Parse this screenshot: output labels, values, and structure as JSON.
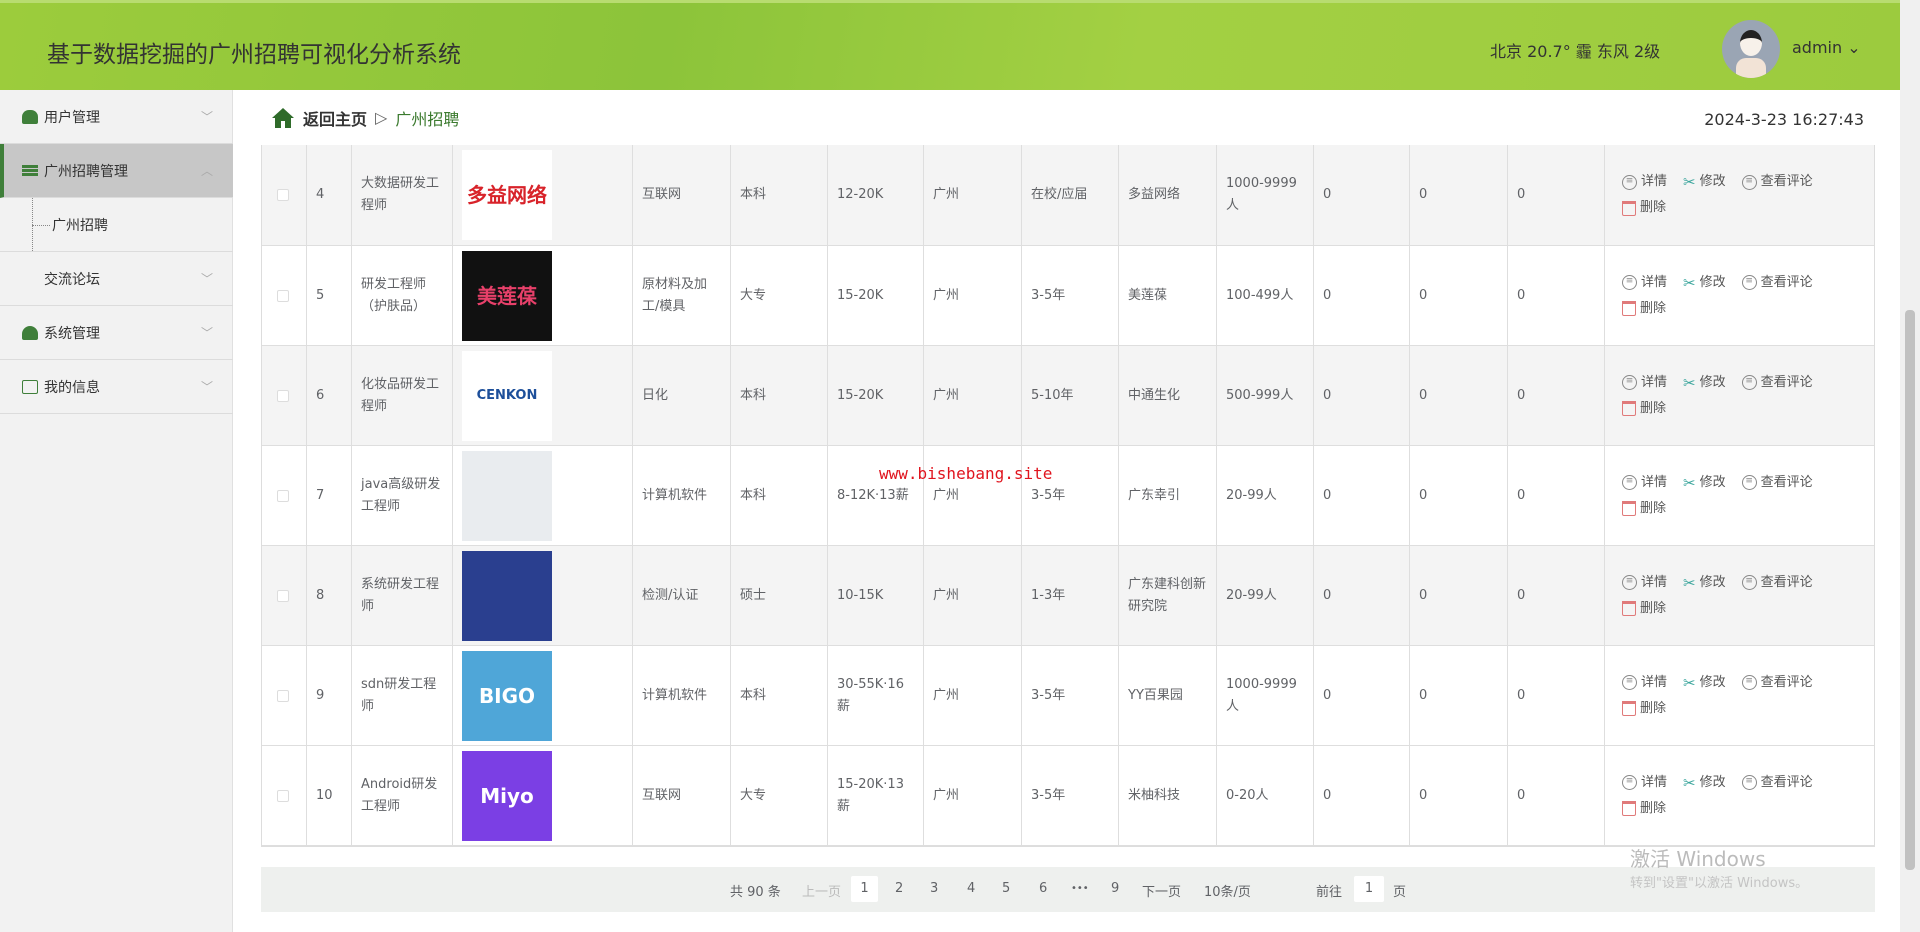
{
  "header": {
    "title": "基于数据挖掘的广州招聘可视化分析系统",
    "weather": "北京 20.7° 霾 东风 2级",
    "user": "admin ⌄"
  },
  "sidebar": {
    "items": [
      {
        "label": "用户管理",
        "icon": "user-icon"
      },
      {
        "label": "广州招聘管理",
        "icon": "list-icon"
      },
      {
        "label": "广州招聘",
        "sub": true
      },
      {
        "label": "交流论坛",
        "icon": "grid-icon"
      },
      {
        "label": "系统管理",
        "icon": "users-icon"
      },
      {
        "label": "我的信息",
        "icon": "card-icon"
      }
    ]
  },
  "breadcrumb": {
    "home": "返回主页",
    "sep": "▷",
    "current": "广州招聘"
  },
  "clock": "2024-3-23 16:27:43",
  "actions": {
    "detail": "详情",
    "edit": "修改",
    "comments": "查看评论",
    "delete": "删除"
  },
  "rows": [
    {
      "id": "4",
      "title": "大数据研发工程师",
      "logo": "多益网络",
      "logo_bg": "#ffffff",
      "logo_fg": "#d8232a",
      "industry": "互联网",
      "edu": "本科",
      "salary": "12-20K",
      "city": "广州",
      "exp": "在校/应届",
      "company": "多益网络",
      "size": "1000-9999人",
      "c1": "0",
      "c2": "0",
      "c3": "0"
    },
    {
      "id": "5",
      "title": "研发工程师（护肤品）",
      "logo": "美莲葆",
      "logo_bg": "#111111",
      "logo_fg": "#e8406a",
      "industry": "原材料及加工/模具",
      "edu": "大专",
      "salary": "15-20K",
      "city": "广州",
      "exp": "3-5年",
      "company": "美莲葆",
      "size": "100-499人",
      "c1": "0",
      "c2": "0",
      "c3": "0"
    },
    {
      "id": "6",
      "title": "化妆品研发工程师",
      "logo": "CENKON",
      "logo_bg": "#ffffff",
      "logo_fg": "#1d4f9a",
      "industry": "日化",
      "edu": "本科",
      "salary": "15-20K",
      "city": "广州",
      "exp": "5-10年",
      "company": "中通生化",
      "size": "500-999人",
      "c1": "0",
      "c2": "0",
      "c3": "0"
    },
    {
      "id": "7",
      "title": "java高级研发工程师",
      "logo": "",
      "logo_bg": "#e9ecef",
      "logo_fg": "#ccc",
      "industry": "计算机软件",
      "edu": "本科",
      "salary": "8-12K·13薪",
      "city": "广州",
      "exp": "3-5年",
      "company": "广东幸引",
      "size": "20-99人",
      "c1": "0",
      "c2": "0",
      "c3": "0"
    },
    {
      "id": "8",
      "title": "系统研发工程师",
      "logo": "",
      "logo_bg": "#2a3f8f",
      "logo_fg": "#fff",
      "industry": "检测/认证",
      "edu": "硕士",
      "salary": "10-15K",
      "city": "广州",
      "exp": "1-3年",
      "company": "广东建科创新研究院",
      "size": "20-99人",
      "c1": "0",
      "c2": "0",
      "c3": "0"
    },
    {
      "id": "9",
      "title": "sdn研发工程师",
      "logo": "BIGO",
      "logo_bg": "#4fa6d8",
      "logo_fg": "#ffffff",
      "industry": "计算机软件",
      "edu": "本科",
      "salary": "30-55K·16薪",
      "city": "广州",
      "exp": "3-5年",
      "company": "YY百果园",
      "size": "1000-9999人",
      "c1": "0",
      "c2": "0",
      "c3": "0"
    },
    {
      "id": "10",
      "title": "Android研发工程师",
      "logo": "Miyo",
      "logo_bg": "#7b3fe4",
      "logo_fg": "#ffffff",
      "industry": "互联网",
      "edu": "大专",
      "salary": "15-20K·13薪",
      "city": "广州",
      "exp": "3-5年",
      "company": "米柚科技",
      "size": "0-20人",
      "c1": "0",
      "c2": "0",
      "c3": "0"
    }
  ],
  "watermark": "www.bishebang.site",
  "pagination": {
    "total": "共 90 条",
    "prev": "上一页",
    "pages": [
      "1",
      "2",
      "3",
      "4",
      "5",
      "6",
      "•••",
      "9"
    ],
    "next": "下一页",
    "size": "10条/页",
    "goto": "前往",
    "goto_value": "1",
    "page_unit": "页"
  },
  "windows": {
    "line1": "激活 Windows",
    "line2": "转到\"设置\"以激活 Windows。"
  }
}
